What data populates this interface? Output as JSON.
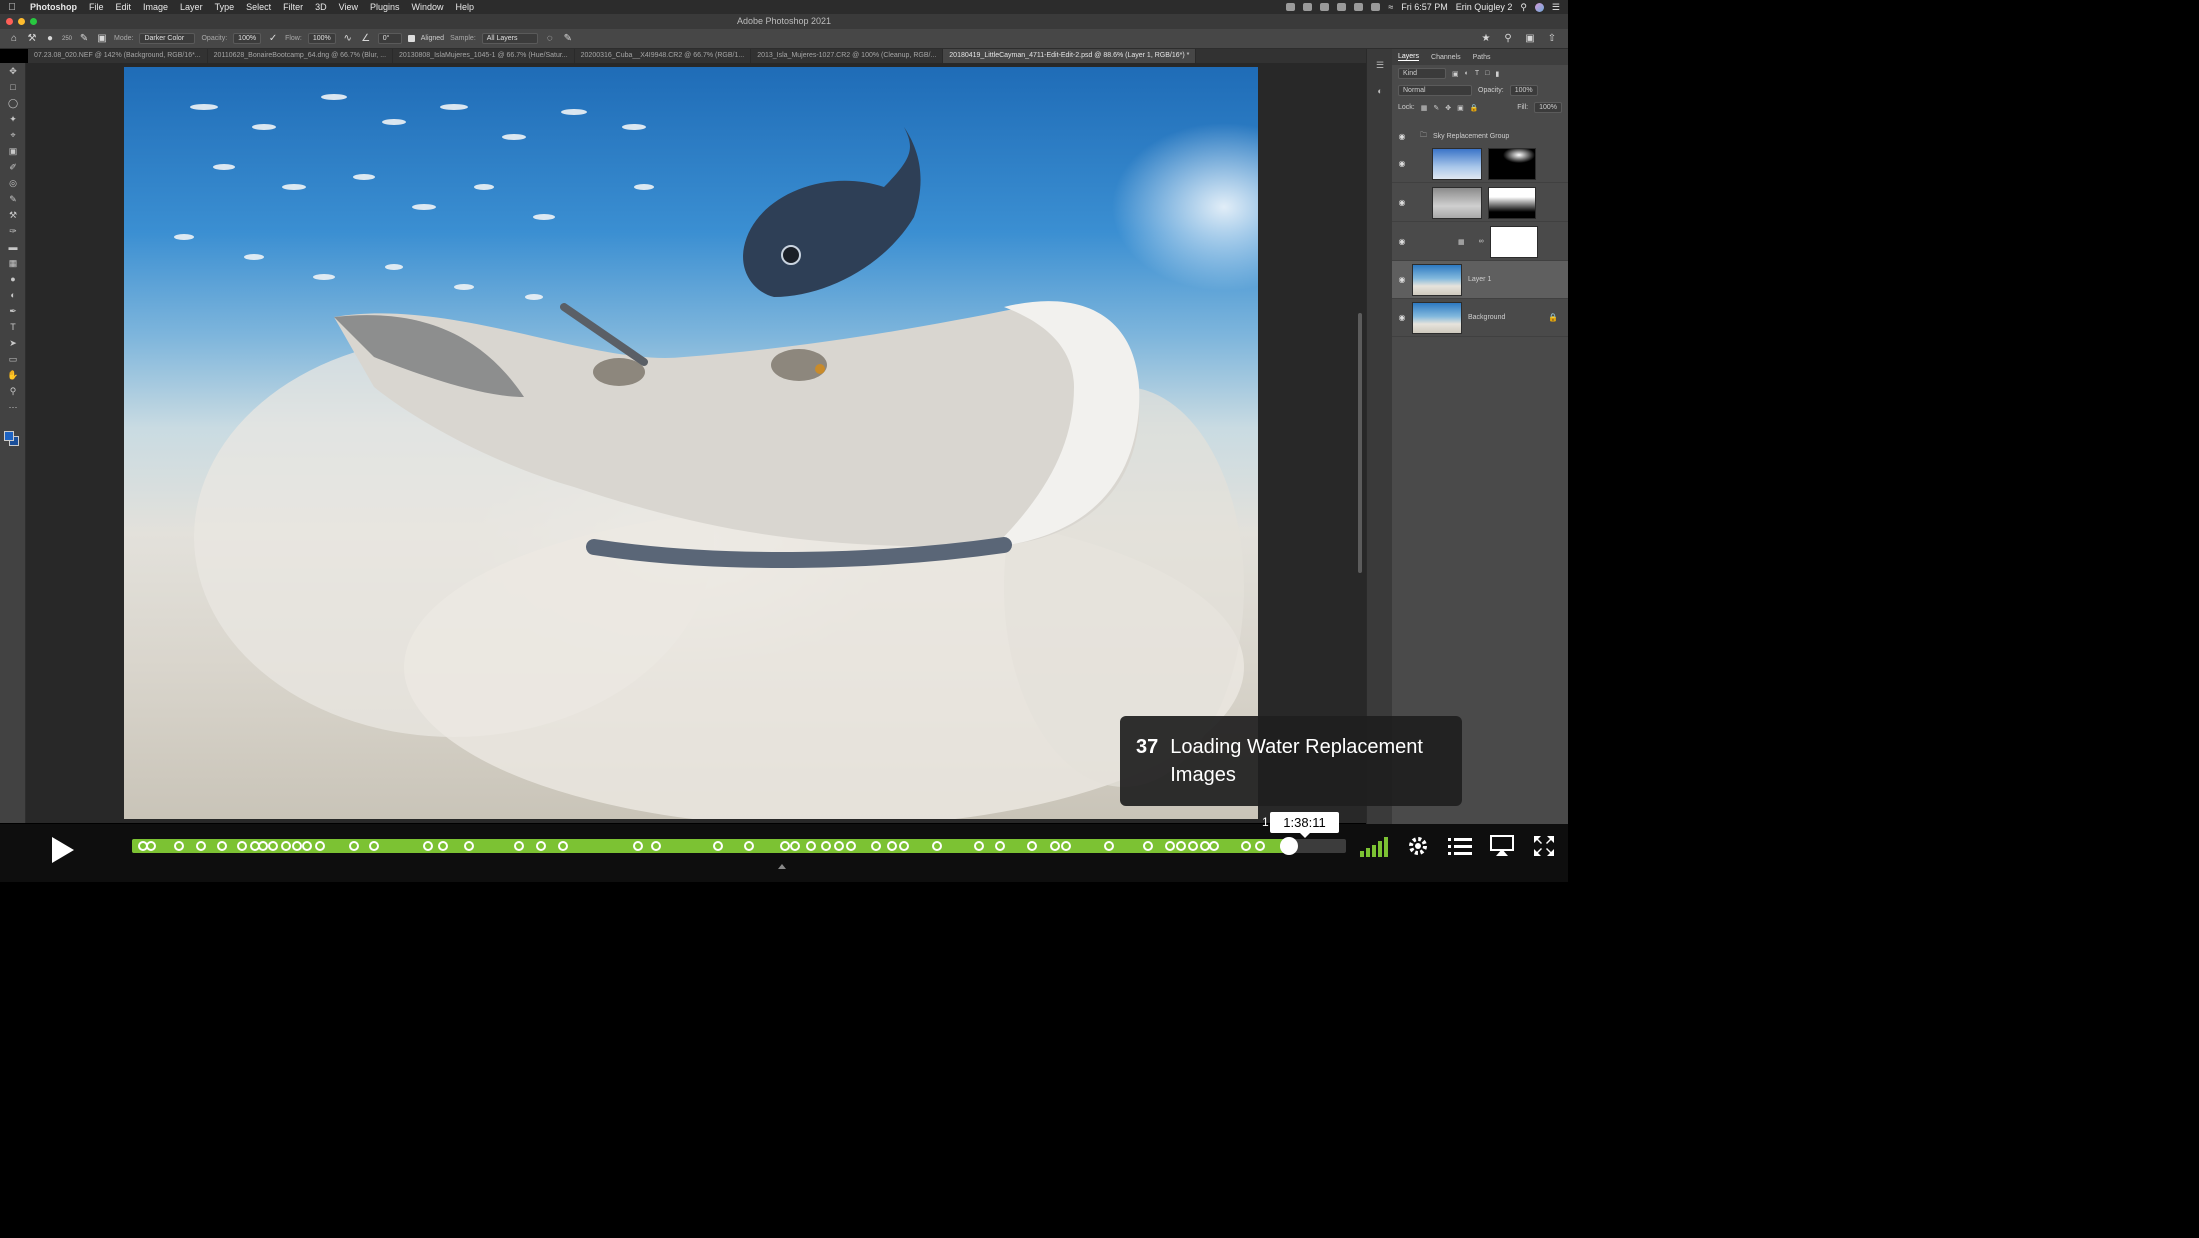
{
  "menubar": {
    "app_name": "Photoshop",
    "menus": [
      "File",
      "Edit",
      "Image",
      "Layer",
      "Type",
      "Select",
      "Filter",
      "3D",
      "View",
      "Plugins",
      "Window",
      "Help"
    ],
    "clock": "Fri 6:57 PM",
    "user": "Erin Quigley 2"
  },
  "window": {
    "title": "Adobe Photoshop 2021"
  },
  "options_bar": {
    "brush_size": "250",
    "mode_label": "Mode:",
    "mode_value": "Darker Color",
    "opacity_label": "Opacity:",
    "opacity_value": "100%",
    "flow_label": "Flow:",
    "flow_value": "100%",
    "angle_value": "0°",
    "aligned_label": "Aligned",
    "sample_label": "Sample:",
    "sample_value": "All Layers"
  },
  "doc_tabs": [
    "07.23.08_020.NEF @ 142% (Background, RGB/16*...",
    "20110628_BonaireBootcamp_64.dng @ 66.7% (Blur, ...",
    "20130808_IslaMujeres_1045-1 @ 66.7% (Hue/Satur...",
    "20200316_Cuba__X4I9948.CR2 @ 66.7% (RGB/1...",
    "2013_Isla_Mujeres-1027.CR2 @ 100% (Cleanup, RGB/...",
    "20180419_LittleCayman_4711-Edit-Edit-2.psd @ 88.6% (Layer 1, RGB/16*) *"
  ],
  "layers_panel": {
    "tabs": [
      "Layers",
      "Channels",
      "Paths"
    ],
    "filter_value": "Kind",
    "blend_mode": "Normal",
    "opacity_label": "Opacity:",
    "opacity_value": "100%",
    "lock_label": "Lock:",
    "fill_label": "Fill:",
    "fill_value": "100%",
    "group_name": "Sky Replacement Group",
    "layer1_name": "Layer 1",
    "background_name": "Background"
  },
  "chapter": {
    "number": "37",
    "title": "Loading Water Replacement Images"
  },
  "player": {
    "time_tooltip": "1:38:11",
    "time_prefix": "1",
    "progress": 0.953,
    "accent_color": "#7cc233",
    "chapter_marks": [
      0.009,
      0.016,
      0.039,
      0.057,
      0.074,
      0.091,
      0.101,
      0.108,
      0.116,
      0.127,
      0.136,
      0.144,
      0.155,
      0.183,
      0.199,
      0.244,
      0.256,
      0.278,
      0.319,
      0.337,
      0.355,
      0.417,
      0.432,
      0.483,
      0.508,
      0.538,
      0.546,
      0.559,
      0.572,
      0.582,
      0.592,
      0.613,
      0.626,
      0.636,
      0.663,
      0.698,
      0.715,
      0.741,
      0.76,
      0.769,
      0.805,
      0.837,
      0.855,
      0.864,
      0.874,
      0.884,
      0.891,
      0.918,
      0.929,
      0.95
    ]
  }
}
